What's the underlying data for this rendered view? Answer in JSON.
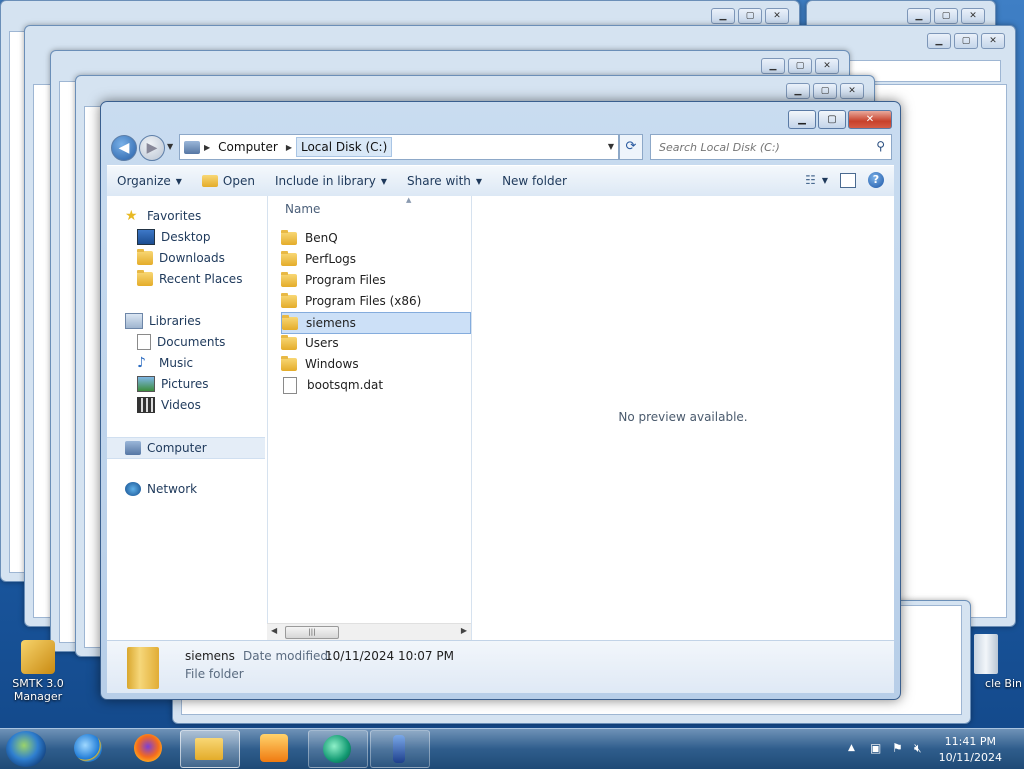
{
  "window": {
    "address": {
      "seg1": "Computer",
      "seg2": "Local Disk (C:)"
    },
    "search_placeholder": "Search Local Disk (C:)",
    "toolbar": {
      "organize": "Organize",
      "open": "Open",
      "include": "Include in library",
      "share": "Share with",
      "new_folder": "New folder"
    },
    "nav": {
      "favorites": "Favorites",
      "desktop": "Desktop",
      "downloads": "Downloads",
      "recent": "Recent Places",
      "libraries": "Libraries",
      "documents": "Documents",
      "music": "Music",
      "pictures": "Pictures",
      "videos": "Videos",
      "computer": "Computer",
      "network": "Network"
    },
    "column_name": "Name",
    "files": [
      "BenQ",
      "PerfLogs",
      "Program Files",
      "Program Files (x86)",
      "siemens",
      "Users",
      "Windows",
      "bootsqm.dat"
    ],
    "selected_file": "siemens",
    "preview_text": "No preview available.",
    "details": {
      "name": "siemens",
      "type": "File folder",
      "modified_label": "Date modified:",
      "modified_value": "10/11/2024 10:07 PM"
    }
  },
  "desktop_icons": {
    "smtk": "SMTK 3.0 Manager",
    "recycle": "cle Bin"
  },
  "taskbar": {
    "time": "11:41 PM",
    "date": "10/11/2024"
  }
}
